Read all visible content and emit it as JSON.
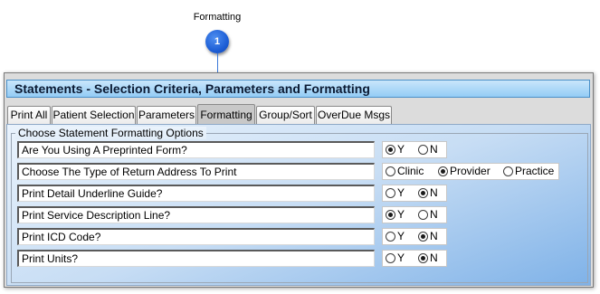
{
  "callout": {
    "label": "Formatting",
    "number": "1"
  },
  "window": {
    "title": "Statements - Selection Criteria, Parameters and Formatting"
  },
  "tabs": [
    {
      "label": "Print All",
      "active": false
    },
    {
      "label": "Patient Selection",
      "active": false
    },
    {
      "label": "Parameters",
      "active": false
    },
    {
      "label": "Formatting",
      "active": true
    },
    {
      "label": "Group/Sort",
      "active": false
    },
    {
      "label": "OverDue Msgs",
      "active": false
    }
  ],
  "group": {
    "legend": "Choose Statement Formatting Options"
  },
  "rows": [
    {
      "question": "Are You Using A Preprinted Form?",
      "options": [
        "Y",
        "N"
      ],
      "selected": "Y"
    },
    {
      "question": "Choose The Type of Return Address To Print",
      "options": [
        "Clinic",
        "Provider",
        "Practice"
      ],
      "selected": "Provider"
    },
    {
      "question": "Print Detail Underline Guide?",
      "options": [
        "Y",
        "N"
      ],
      "selected": "N"
    },
    {
      "question": "Print Service Description Line?",
      "options": [
        "Y",
        "N"
      ],
      "selected": "Y"
    },
    {
      "question": "Print ICD Code?",
      "options": [
        "Y",
        "N"
      ],
      "selected": "N"
    },
    {
      "question": "Print Units?",
      "options": [
        "Y",
        "N"
      ],
      "selected": "N"
    }
  ]
}
